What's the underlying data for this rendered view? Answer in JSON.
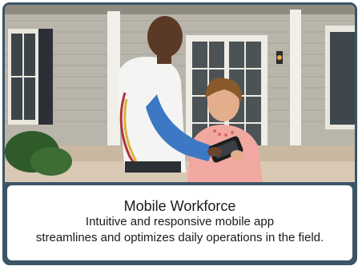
{
  "card": {
    "image_alt": "Field technician showing a smartphone to a homeowner on a porch",
    "title": "Mobile Workforce",
    "description_line1": "Intuitive and responsive mobile app",
    "description_line2": "streamlines and optimizes daily operations in the field."
  },
  "colors": {
    "frame": "#3a5566",
    "caption_bg": "#ffffff",
    "text": "#1a1a1a"
  }
}
